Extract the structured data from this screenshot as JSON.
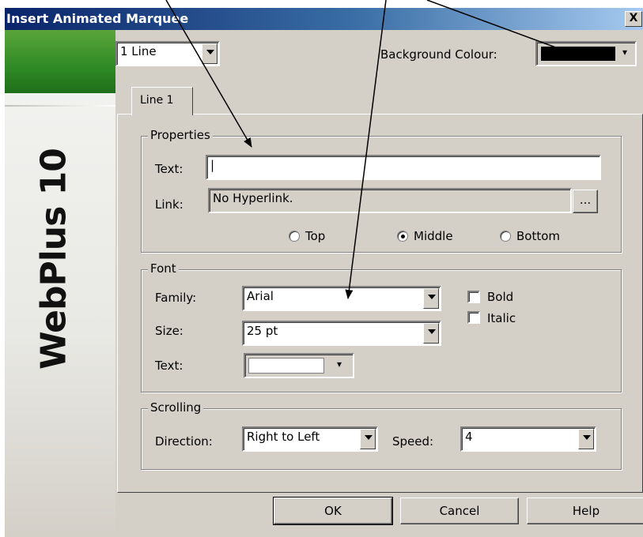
{
  "window": {
    "title": "Insert Animated Marquee",
    "close_glyph": "X"
  },
  "brand": {
    "logo_text": "WebPlus 10"
  },
  "top": {
    "lines_select_value": "1 Line",
    "background_label": "Background Colour:",
    "background_color": "#000000"
  },
  "tabs": [
    {
      "label": "Line 1"
    }
  ],
  "properties": {
    "group_label": "Properties",
    "text_label": "Text:",
    "text_value": "|",
    "link_label": "Link:",
    "link_value": "No Hyperlink.",
    "browse_label": "...",
    "position_options": [
      {
        "label": "Top",
        "selected": false
      },
      {
        "label": "Middle",
        "selected": true
      },
      {
        "label": "Bottom",
        "selected": false
      }
    ]
  },
  "font": {
    "group_label": "Font",
    "family_label": "Family:",
    "family_value": "Arial",
    "size_label": "Size:",
    "size_value": "25 pt",
    "text_label": "Text:",
    "text_color": "#ffffff",
    "bold_label": "Bold",
    "bold_checked": false,
    "italic_label": "Italic",
    "italic_checked": false
  },
  "scrolling": {
    "group_label": "Scrolling",
    "direction_label": "Direction:",
    "direction_value": "Right to Left",
    "speed_label": "Speed:",
    "speed_value": "4"
  },
  "buttons": {
    "ok": "OK",
    "cancel": "Cancel",
    "help": "Help"
  },
  "annotation_arrows": {
    "count": 3,
    "color": "#000000"
  }
}
